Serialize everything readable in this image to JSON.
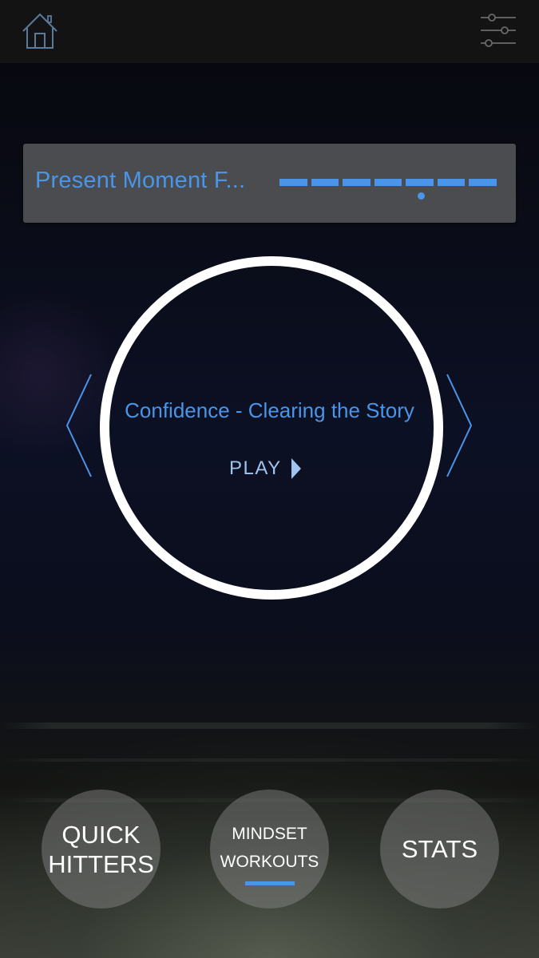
{
  "header": {
    "home_icon": "home-icon",
    "filter_icon": "sliders-icon"
  },
  "track_selector": {
    "title": "Present Moment F...",
    "segment_count": 7,
    "selected_segment_index": 4,
    "accent_color": "#4a95e8"
  },
  "player": {
    "session_title": "Confidence - Clearing the Story",
    "play_label": "PLAY",
    "prev_icon": "chevron-left-icon",
    "next_icon": "chevron-right-icon",
    "play_icon": "play-triangle-icon"
  },
  "bottom_nav": {
    "quick_hitters_line1": "QUICK",
    "quick_hitters_line2": "HITTERS",
    "mindset_line1": "MINDSET",
    "mindset_line2": "WORKOUTS",
    "stats_label": "STATS",
    "active_tab": "MINDSET WORKOUTS"
  }
}
